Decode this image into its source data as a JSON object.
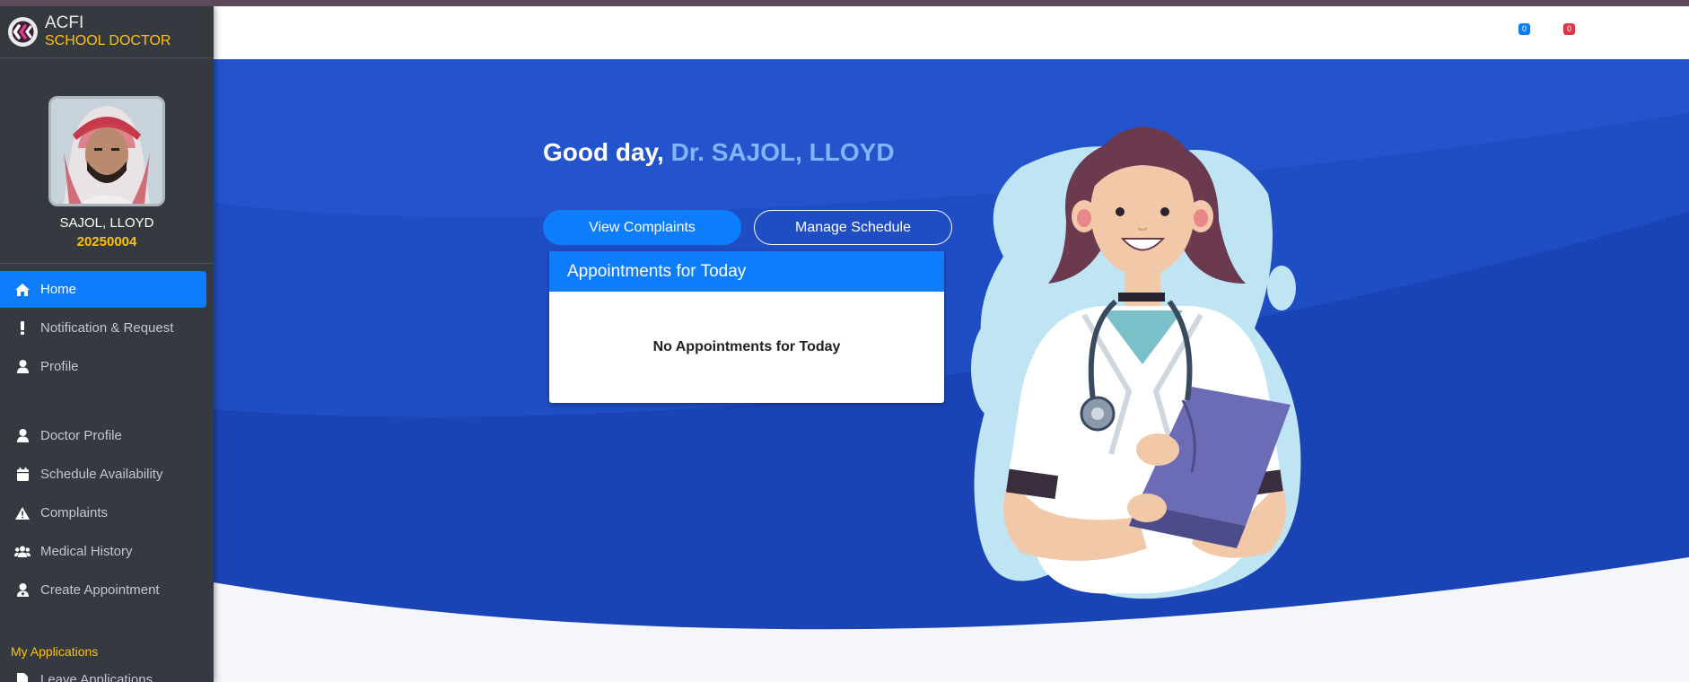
{
  "brand": {
    "title": "ACFI",
    "subtitle": "SCHOOL DOCTOR"
  },
  "user": {
    "name": "SAJOL, LLOYD",
    "id": "20250004"
  },
  "nav": {
    "home": "Home",
    "notification": "Notification & Request",
    "profile": "Profile",
    "doctor_profile": "Doctor Profile",
    "schedule": "Schedule Availability",
    "complaints": "Complaints",
    "medical_history": "Medical History",
    "create_appointment": "Create Appointment",
    "section_header": "My Applications",
    "leave_applications": "Leave Applications"
  },
  "header": {
    "badge_messages": "0",
    "badge_notifications": "0"
  },
  "hero": {
    "greeting": "Good day, ",
    "doctor_name": "Dr. SAJOL, LLOYD",
    "view_complaints": "View Complaints",
    "manage_schedule": "Manage Schedule"
  },
  "appointments": {
    "title": "Appointments for Today",
    "empty": "No Appointments for Today"
  },
  "colors": {
    "accent": "#0d7dfb",
    "sidebar_bg": "#343a40",
    "brand_yellow": "#ffc107",
    "hero_blue": "#1e4fc7"
  }
}
